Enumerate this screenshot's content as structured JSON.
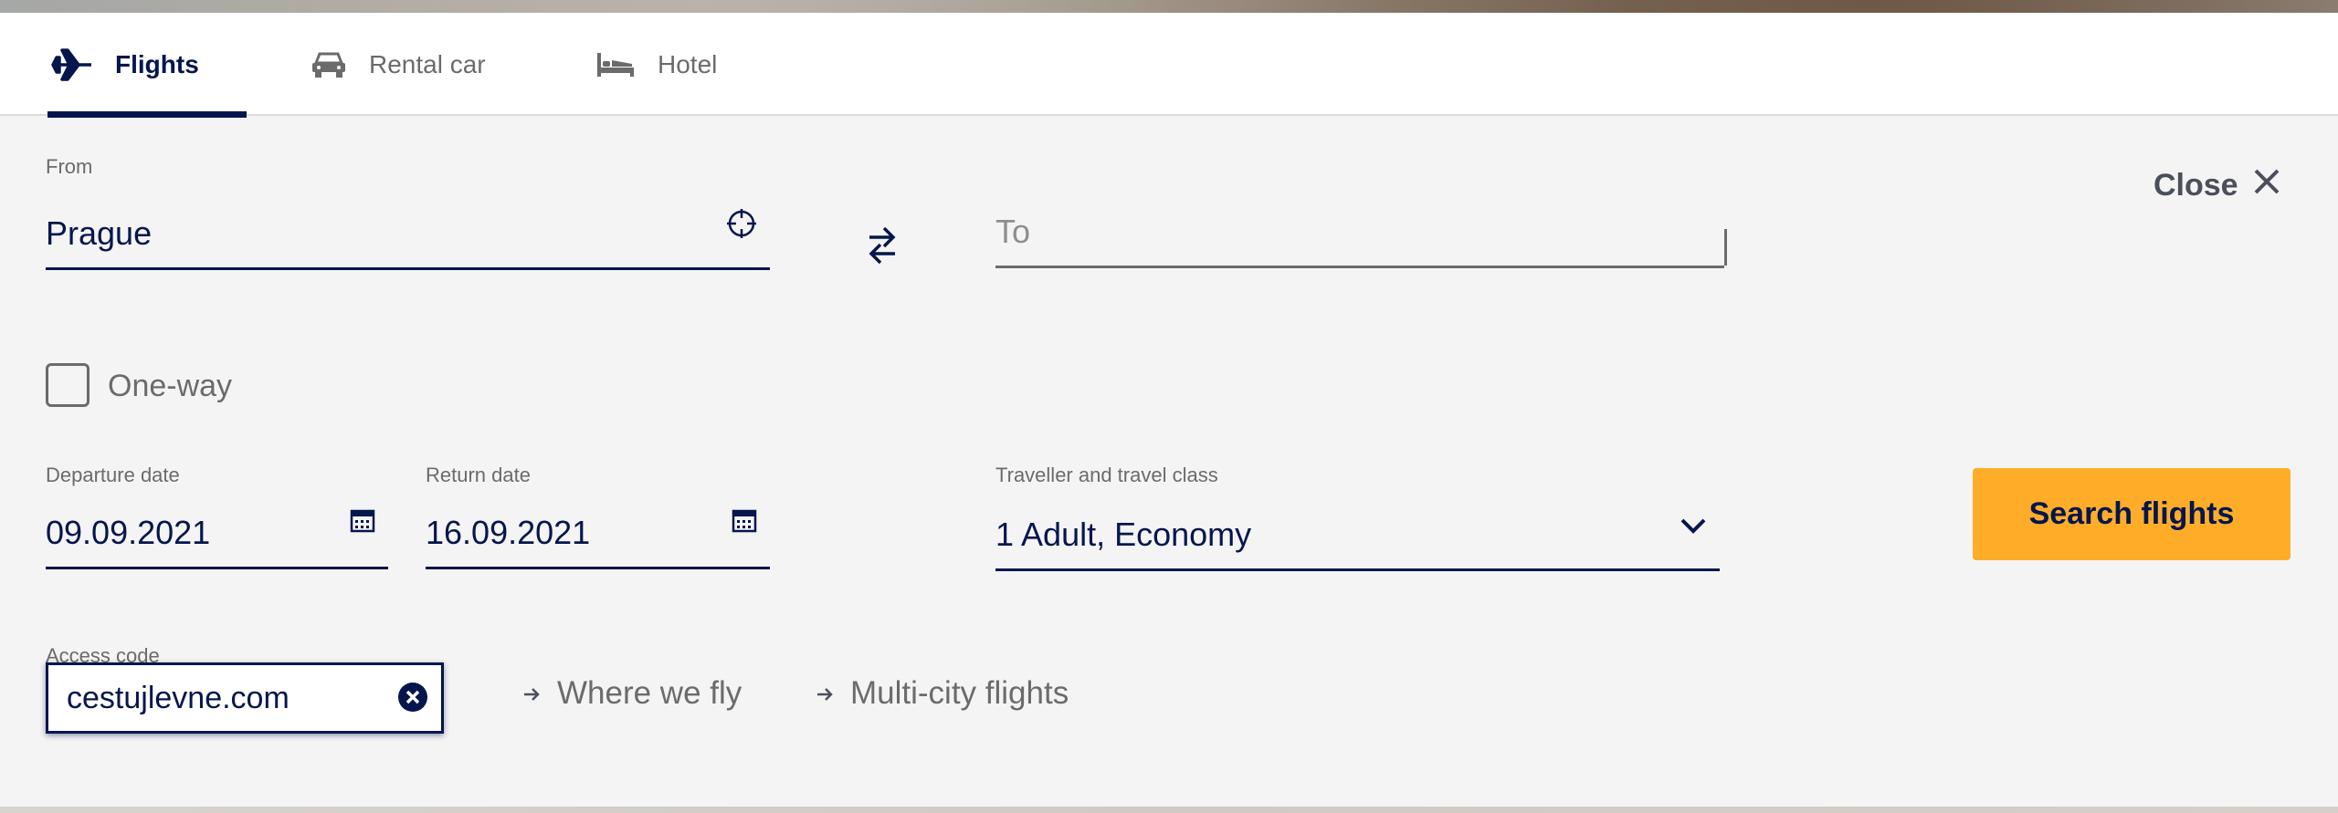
{
  "tabs": [
    {
      "label": "Flights",
      "icon": "airplane-icon",
      "active": true
    },
    {
      "label": "Rental car",
      "icon": "car-icon",
      "active": false
    },
    {
      "label": "Hotel",
      "icon": "bed-icon",
      "active": false
    }
  ],
  "from": {
    "label": "From",
    "value": "Prague"
  },
  "to": {
    "placeholder": "To"
  },
  "close_label": "Close",
  "one_way": {
    "label": "One-way",
    "checked": false
  },
  "departure": {
    "label": "Departure date",
    "value": "09.09.2021"
  },
  "return_date": {
    "label": "Return date",
    "value": "16.09.2021"
  },
  "traveller": {
    "label": "Traveller and travel class",
    "value": "1 Adult, Economy"
  },
  "search_button": "Search flights",
  "access_code": {
    "label": "Access code",
    "value": "cestujlevne.com"
  },
  "links": {
    "where_we_fly": "Where we fly",
    "multi_city": "Multi-city flights"
  },
  "colors": {
    "brand_navy": "#05164d",
    "accent_yellow": "#ffad29",
    "panel_bg": "#f4f4f4"
  }
}
